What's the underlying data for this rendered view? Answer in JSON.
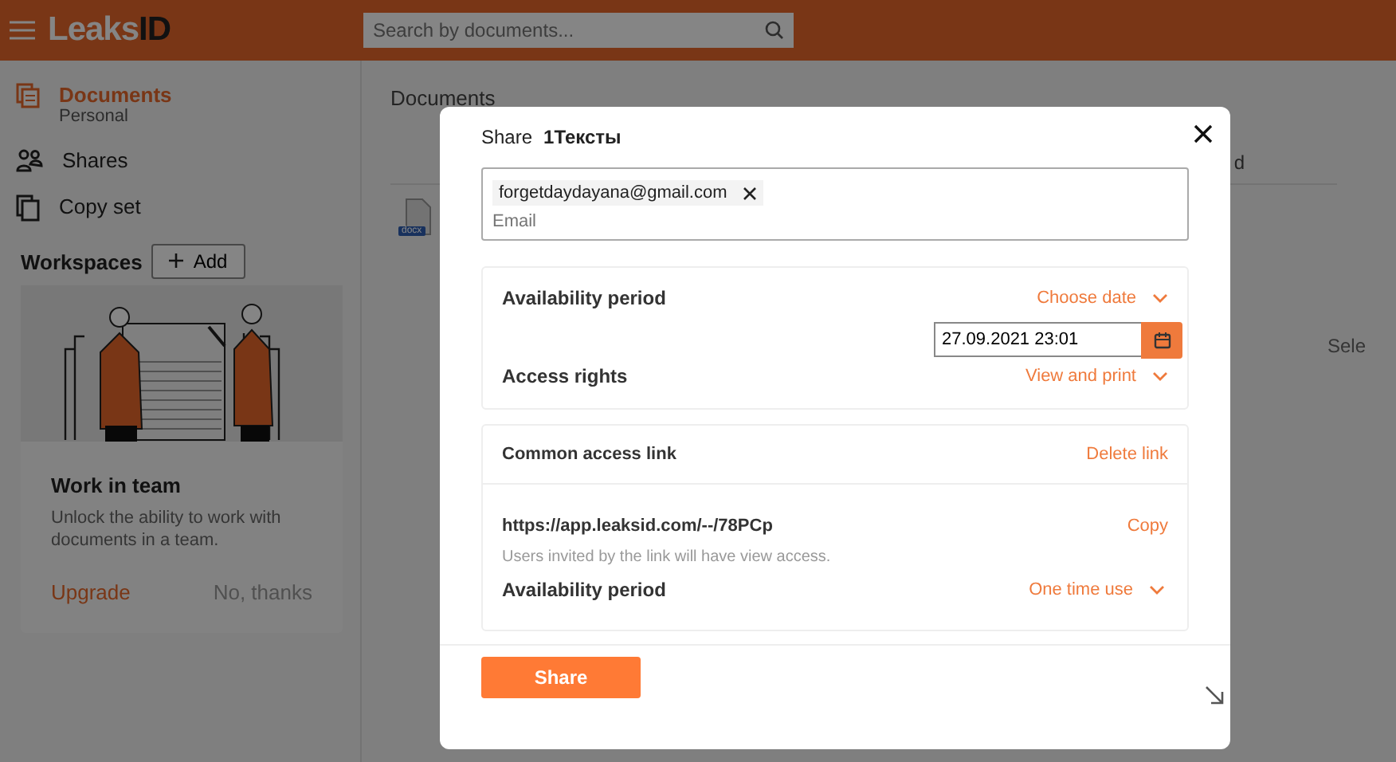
{
  "header": {
    "logo": {
      "part1": "Leaks",
      "part2": "ID"
    },
    "search": {
      "placeholder": "Search by documents..."
    }
  },
  "sidebar": {
    "items": [
      {
        "kind": "documents",
        "label": "Documents",
        "sublabel": "Personal",
        "selected": true
      },
      {
        "kind": "users",
        "label": "Shares",
        "selected": false
      },
      {
        "kind": "copy",
        "label": "Copy set",
        "selected": false
      }
    ],
    "workspaces": {
      "title": "Workspaces",
      "add_button": "Add"
    },
    "promo": {
      "title": "Work in team",
      "text": "Unlock the ability to work with documents in a team.",
      "primary": "Upgrade",
      "secondary": "No, thanks"
    }
  },
  "main": {
    "title": "Documents",
    "column_3": "d",
    "file": {
      "badge": "docx"
    },
    "hint": "Sele"
  },
  "dialog": {
    "title": "Share",
    "document": "1Тексты",
    "recipients": [
      {
        "email": "forgetdaydayana@gmail.com"
      }
    ],
    "email_placeholder": "Email",
    "availability": {
      "label": "Availability period",
      "value": "Choose date",
      "date": "27.09.2021 23:01"
    },
    "access_rights": {
      "label": "Access rights",
      "value": "View and print"
    },
    "link": {
      "title": "Common access link",
      "delete": "Delete link",
      "url": "https://app.leaksid.com/--/78PCp",
      "copy": "Copy",
      "note": "Users invited by the link will have view access.",
      "availability_label": "Availability period",
      "availability_value": "One time use"
    },
    "submit": "Share"
  }
}
